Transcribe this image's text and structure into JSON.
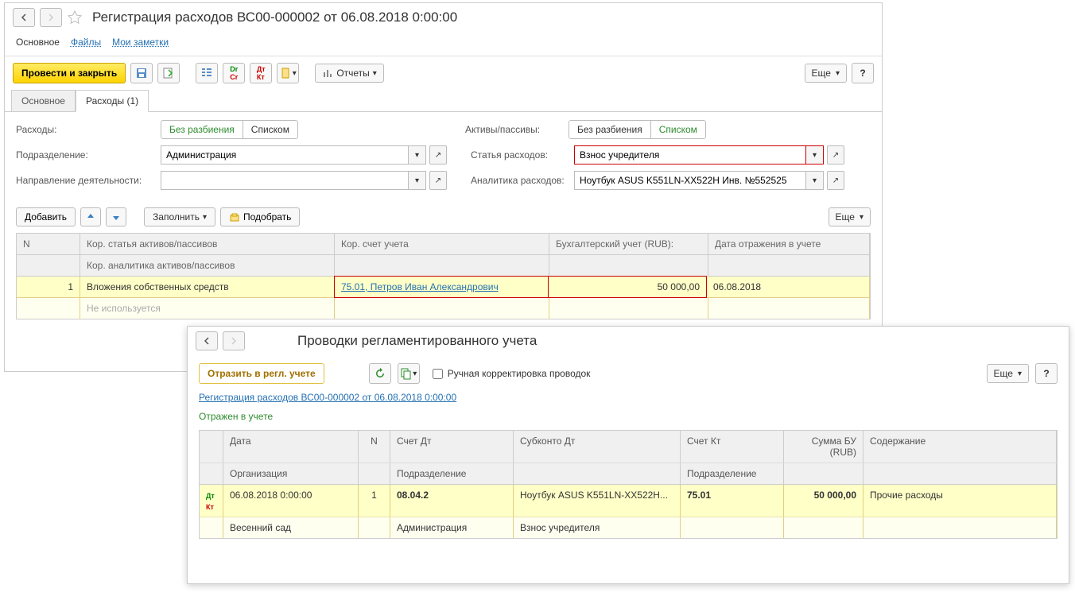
{
  "win1": {
    "title": "Регистрация расходов ВС00-000002 от 06.08.2018 0:00:00",
    "topTabs": {
      "main": "Основное",
      "files": "Файлы",
      "notes": "Мои заметки"
    },
    "toolbar": {
      "postClose": "Провести и закрыть",
      "reports": "Отчеты",
      "more": "Еще",
      "help": "?"
    },
    "subTabs": {
      "main": "Основное",
      "expenses": "Расходы (1)"
    },
    "labels": {
      "expenses": "Расходы:",
      "division": "Подразделение:",
      "direction": "Направление деятельности:",
      "assets": "Активы/пассивы:",
      "article": "Статья расходов:",
      "analytics": "Аналитика расходов:"
    },
    "radios": {
      "noSplit": "Без разбиения",
      "list": "Списком"
    },
    "fields": {
      "division": "Администрация",
      "direction": "",
      "article": "Взнос учредителя",
      "analytics": "Ноутбук ASUS K551LN-XX522H Инв. №552525"
    },
    "actions": {
      "add": "Добавить",
      "fill": "Заполнить",
      "pick": "Подобрать",
      "more": "Еще"
    },
    "grid": {
      "headers": {
        "n": "N",
        "article": "Кор. статья активов/пассивов",
        "analytics": "Кор. аналитика активов/пассивов",
        "account": "Кор. счет учета",
        "amount": "Бухгалтерский учет (RUB):",
        "date": "Дата отражения в учете"
      },
      "row": {
        "n": "1",
        "article": "Вложения собственных средств",
        "analytics": "Не используется",
        "account": "75.01, Петров Иван Александрович",
        "amount": "50 000,00",
        "date": "06.08.2018"
      }
    }
  },
  "win2": {
    "title": "Проводки регламентированного учета",
    "toolbar": {
      "reflect": "Отразить в регл. учете",
      "manual": "Ручная корректировка проводок",
      "more": "Еще",
      "help": "?"
    },
    "docLink": "Регистрация расходов ВС00-000002 от 06.08.2018 0:00:00",
    "status": "Отражен в учете",
    "grid": {
      "headers": {
        "date": "Дата",
        "n": "N",
        "dt": "Счет Дт",
        "sub": "Субконто Дт",
        "kt": "Счет Кт",
        "sum": "Сумма БУ (RUB)",
        "cont": "Содержание",
        "org": "Организация",
        "div": "Подразделение",
        "div2": "Подразделение"
      },
      "row": {
        "date": "06.08.2018 0:00:00",
        "n": "1",
        "dt": "08.04.2",
        "sub": "Ноутбук ASUS K551LN-XX522H...",
        "kt": "75.01",
        "sum": "50 000,00",
        "cont": "Прочие расходы",
        "org": "Весенний сад",
        "div": "Администрация",
        "sub2": "Взнос учредителя"
      }
    }
  }
}
